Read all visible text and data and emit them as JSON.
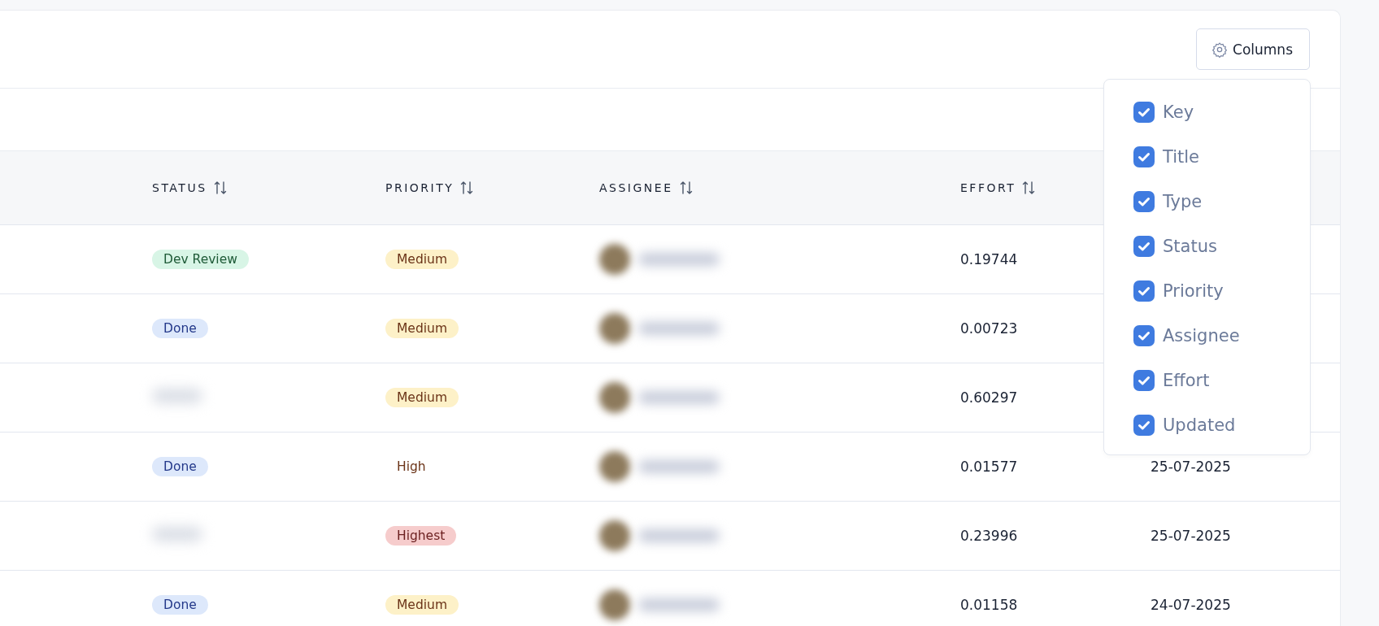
{
  "toolbar": {
    "columns_button": "Columns"
  },
  "table": {
    "columns": [
      {
        "label": "STATUS"
      },
      {
        "label": "PRIORITY"
      },
      {
        "label": "ASSIGNEE"
      },
      {
        "label": "EFFORT"
      }
    ],
    "rows": [
      {
        "status": {
          "kind": "dev-review",
          "text": "Dev Review"
        },
        "priority": {
          "kind": "medium",
          "text": "Medium"
        },
        "effort": "0.19744"
      },
      {
        "status": {
          "kind": "done",
          "text": "Done"
        },
        "priority": {
          "kind": "medium",
          "text": "Medium"
        },
        "effort": "0.00723"
      },
      {
        "status": {
          "kind": "blurred"
        },
        "priority": {
          "kind": "medium",
          "text": "Medium"
        },
        "effort": "0.60297"
      },
      {
        "status": {
          "kind": "done",
          "text": "Done"
        },
        "priority": {
          "kind": "high",
          "text": "High"
        },
        "effort": "0.01577",
        "updated": "25-07-2025"
      },
      {
        "status": {
          "kind": "blurred"
        },
        "priority": {
          "kind": "highest",
          "text": "Highest"
        },
        "effort": "0.23996",
        "updated": "25-07-2025"
      },
      {
        "status": {
          "kind": "done",
          "text": "Done"
        },
        "priority": {
          "kind": "medium",
          "text": "Medium"
        },
        "effort": "0.01158",
        "updated": "24-07-2025"
      }
    ]
  },
  "column_menu": {
    "items": [
      {
        "label": "Key",
        "checked": true
      },
      {
        "label": "Title",
        "checked": true
      },
      {
        "label": "Type",
        "checked": true
      },
      {
        "label": "Status",
        "checked": true
      },
      {
        "label": "Priority",
        "checked": true
      },
      {
        "label": "Assignee",
        "checked": true
      },
      {
        "label": "Effort",
        "checked": true
      },
      {
        "label": "Updated",
        "checked": true
      }
    ]
  }
}
